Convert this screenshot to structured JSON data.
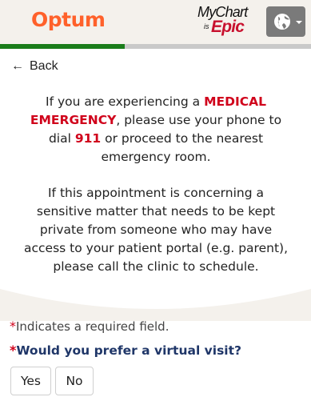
{
  "header": {
    "brand": "Optum",
    "mychart_logo": {
      "line1": "MyChart",
      "is_text": "is",
      "epic_text": "Epic"
    },
    "language_button_icon": "globe-icon",
    "colors": {
      "brand": "#ff612b",
      "header_bg": "#f4f1ec",
      "epic": "#c8102e"
    }
  },
  "progress": {
    "fraction": 0.4,
    "color": "#1a7d1a"
  },
  "back": {
    "label": "Back",
    "icon": "arrow-left-icon"
  },
  "notice": {
    "p1_before": "If you are experiencing a ",
    "p1_emergency": "MEDICAL EMERGENCY",
    "p1_middle": ", please use your phone to dial ",
    "p1_number": "911",
    "p1_after": " or proceed to the nearest emergency room.",
    "p2": "If this appointment is concerning a sensitive matter that needs to be kept private from someone who may have access to your patient portal (e.g. parent), please call the clinic to schedule."
  },
  "form": {
    "required_marker": "*",
    "required_note": "Indicates a required field.",
    "question": "Would you prefer a virtual visit?",
    "options": [
      "Yes",
      "No"
    ]
  }
}
